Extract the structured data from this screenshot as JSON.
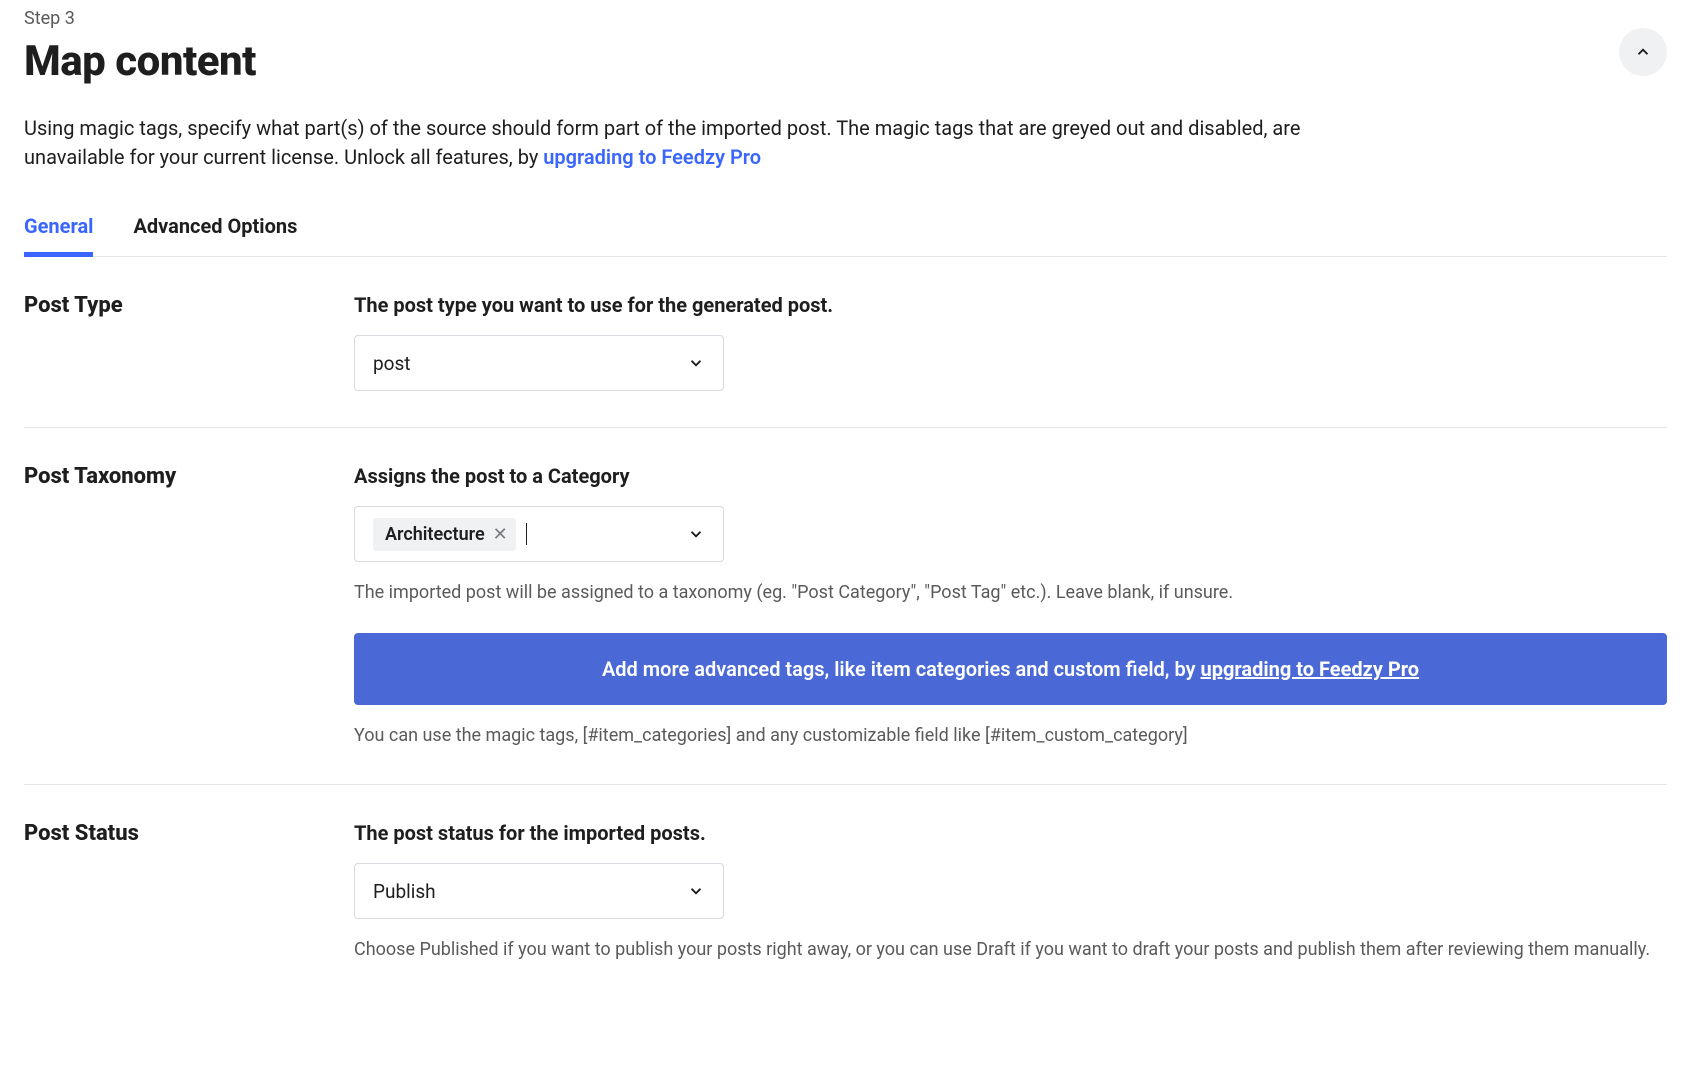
{
  "step": "Step 3",
  "title": "Map content",
  "intro_text": "Using magic tags, specify what part(s) of the source should form part of the imported post. The magic tags that are greyed out and disabled, are unavailable for your current license. Unlock all features, by ",
  "intro_link": "upgrading to Feedzy Pro",
  "tabs": {
    "general": "General",
    "advanced": "Advanced Options"
  },
  "post_type": {
    "heading": "Post Type",
    "label": "The post type you want to use for the generated post.",
    "value": "post"
  },
  "post_taxonomy": {
    "heading": "Post Taxonomy",
    "label": "Assigns the post to a Category",
    "tag": "Architecture",
    "help1": "The imported post will be assigned to a taxonomy (eg. \"Post Category\", \"Post Tag\" etc.). Leave blank, if unsure.",
    "banner_text": "Add more advanced tags, like item categories and custom field, by ",
    "banner_link": "upgrading to Feedzy Pro",
    "help2": "You can use the magic tags, [#item_categories] and any customizable field like [#item_custom_category]"
  },
  "post_status": {
    "heading": "Post Status",
    "label": "The post status for the imported posts.",
    "value": "Publish",
    "help": "Choose Published if you want to publish your posts right away, or you can use Draft if you want to draft your posts and publish them after reviewing them manually."
  }
}
